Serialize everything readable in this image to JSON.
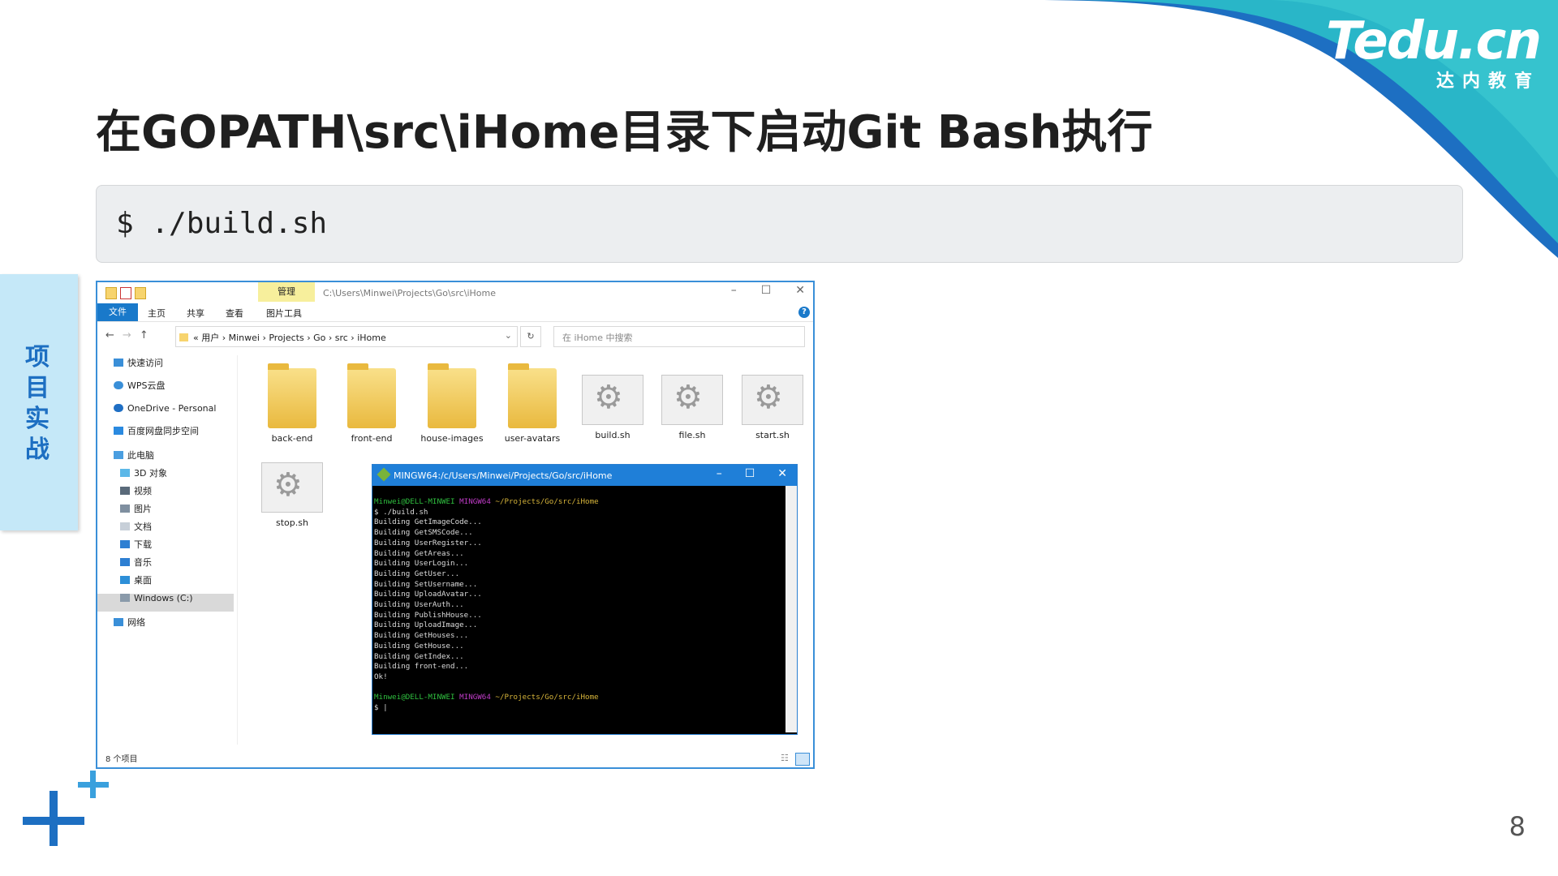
{
  "slide": {
    "title": "在GOPATH\\src\\iHome目录下启动Git Bash执行",
    "command": "$ ./build.sh",
    "side_tab": "项目实战",
    "page_number": "8",
    "logo_brand": "Tedu.cn",
    "logo_sub": "达内教育",
    "colors": {
      "accent_blue": "#1d6fc2",
      "teal": "#29b6c8",
      "light_blue": "#c5e8f8"
    }
  },
  "explorer": {
    "ribbon_context_tab": "管理",
    "title_path": "C:\\Users\\Minwei\\Projects\\Go\\src\\iHome",
    "ribbon_tabs": [
      "文件",
      "主页",
      "共享",
      "查看",
      "图片工具"
    ],
    "breadcrumb": "«  用户  ›  Minwei  ›  Projects  ›  Go  ›  src  ›  iHome",
    "search_placeholder": "在 iHome 中搜索",
    "nav": [
      "快速访问",
      "WPS云盘",
      "OneDrive - Personal",
      "百度网盘同步空间",
      "此电脑",
      "3D 对象",
      "视频",
      "图片",
      "文档",
      "下载",
      "音乐",
      "桌面",
      "Windows (C:)",
      "网络"
    ],
    "files": [
      "back-end",
      "front-end",
      "house-images",
      "user-avatars",
      "build.sh",
      "file.sh",
      "start.sh",
      "stop.sh"
    ],
    "status": "8 个项目"
  },
  "terminal": {
    "title": "MINGW64:/c/Users/Minwei/Projects/Go/src/iHome",
    "prompt_user": "Minwei@DELL-MINWEI",
    "prompt_env": "MINGW64",
    "prompt_path": "~/Projects/Go/src/iHome",
    "command_line": "$ ./build.sh",
    "output": [
      "Building GetImageCode...",
      "Building GetSMSCode...",
      "Building UserRegister...",
      "Building GetAreas...",
      "Building UserLogin...",
      "Building GetUser...",
      "Building SetUsername...",
      "Building UploadAvatar...",
      "Building UserAuth...",
      "Building PublishHouse...",
      "Building UploadImage...",
      "Building GetHouses...",
      "Building GetHouse...",
      "Building GetIndex...",
      "Building front-end...",
      "Ok!"
    ],
    "cursor_line": "$ |"
  }
}
